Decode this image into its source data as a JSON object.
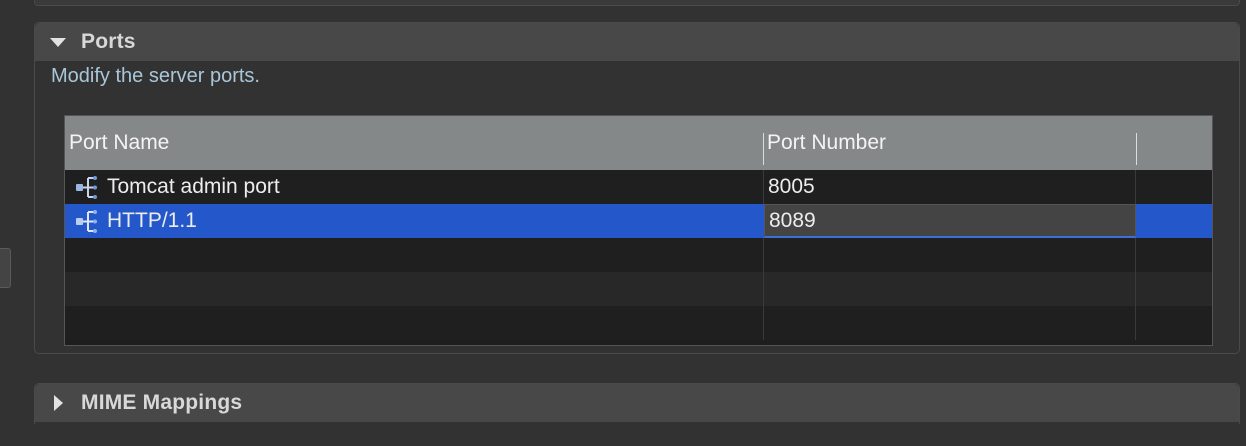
{
  "ports": {
    "title": "Ports",
    "description": "Modify the server ports.",
    "columns": [
      "Port Name",
      "Port Number"
    ],
    "rows": [
      {
        "name": "Tomcat admin port",
        "number": "8005",
        "selected": false
      },
      {
        "name": "HTTP/1.1",
        "number": "8089",
        "selected": true
      }
    ],
    "icon": "port-connector-icon"
  },
  "mime": {
    "title": "MIME Mappings"
  },
  "colors": {
    "selection": "#2457c9",
    "header_bg": "#858889",
    "description": "#a9c6d8"
  }
}
